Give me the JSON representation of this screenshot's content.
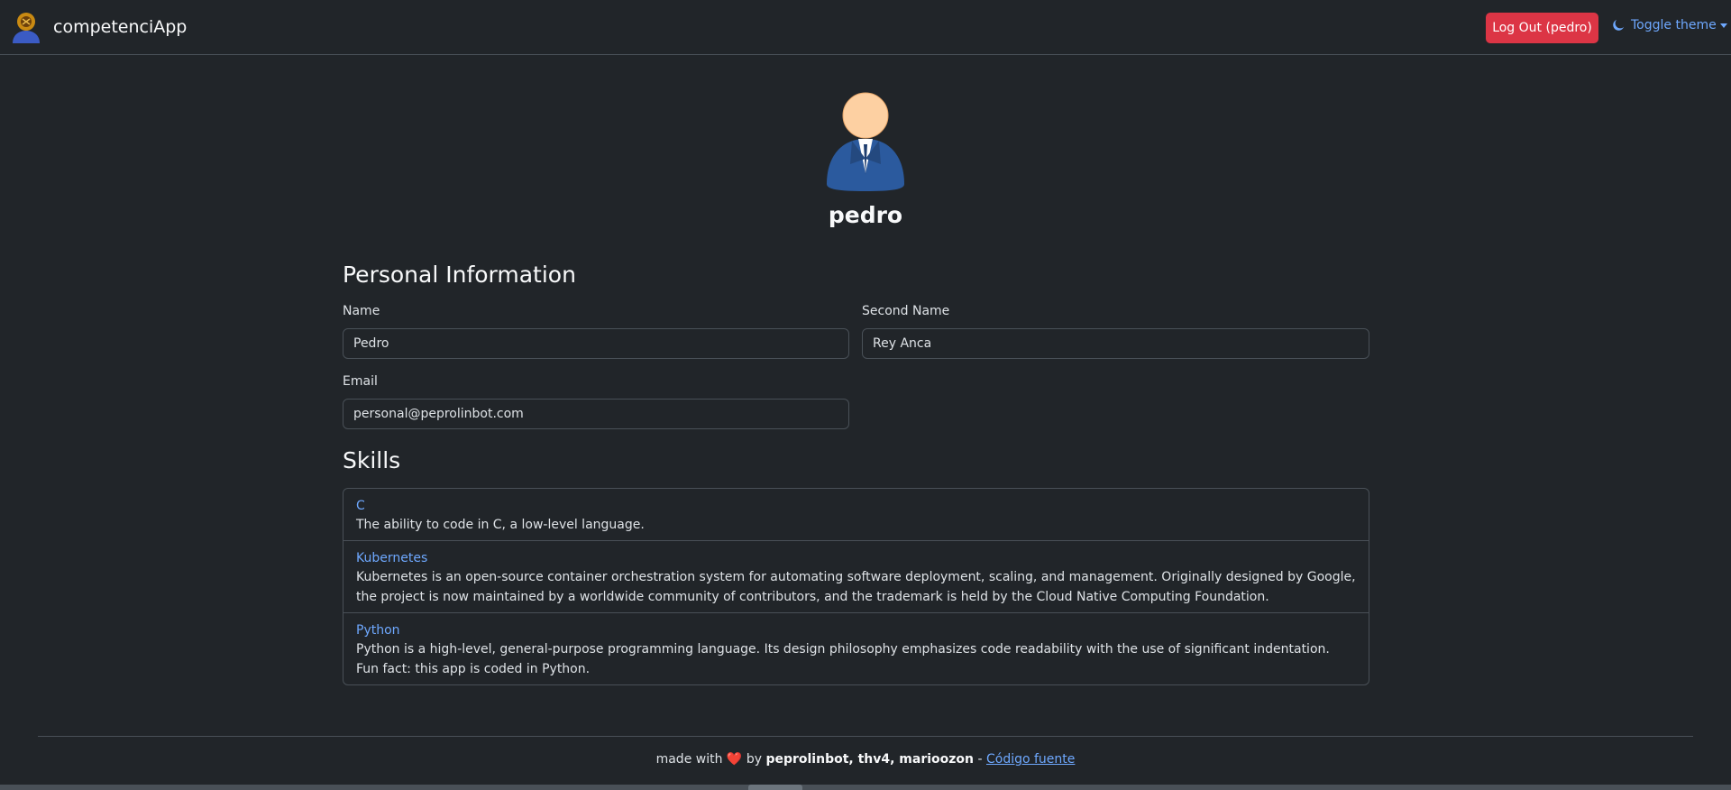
{
  "navbar": {
    "brand": "competenciApp",
    "logout_label": "Log Out (pedro)",
    "theme_label": "Toggle theme"
  },
  "profile": {
    "username": "pedro"
  },
  "personal_info": {
    "title": "Personal Information",
    "name_label": "Name",
    "name_value": "Pedro",
    "second_name_label": "Second Name",
    "second_name_value": "Rey Anca",
    "email_label": "Email",
    "email_value": "personal@peprolinbot.com"
  },
  "skills": {
    "title": "Skills",
    "items": [
      {
        "name": "C",
        "description": "The ability to code in C, a low-level language."
      },
      {
        "name": "Kubernetes",
        "description": "Kubernetes is an open-source container orchestration system for automating software deployment, scaling, and management. Originally designed by Google, the project is now maintained by a worldwide community of contributors, and the trademark is held by the Cloud Native Computing Foundation."
      },
      {
        "name": "Python",
        "description": "Python is a high-level, general-purpose programming language. Its design philosophy emphasizes code readability with the use of significant indentation. Fun fact: this app is coded in Python."
      }
    ]
  },
  "footer": {
    "made_with": "made with",
    "by": "by",
    "authors": "peprolinbot, thv4, marioozon",
    "separator": "-",
    "source_link": "Código fuente"
  },
  "colors": {
    "background": "#212529",
    "danger": "#dc3545",
    "link": "#6ea8fe"
  },
  "icons": [
    "app-logo-icon",
    "moon-icon",
    "caret-down-icon",
    "user-avatar-icon",
    "heart-icon"
  ]
}
